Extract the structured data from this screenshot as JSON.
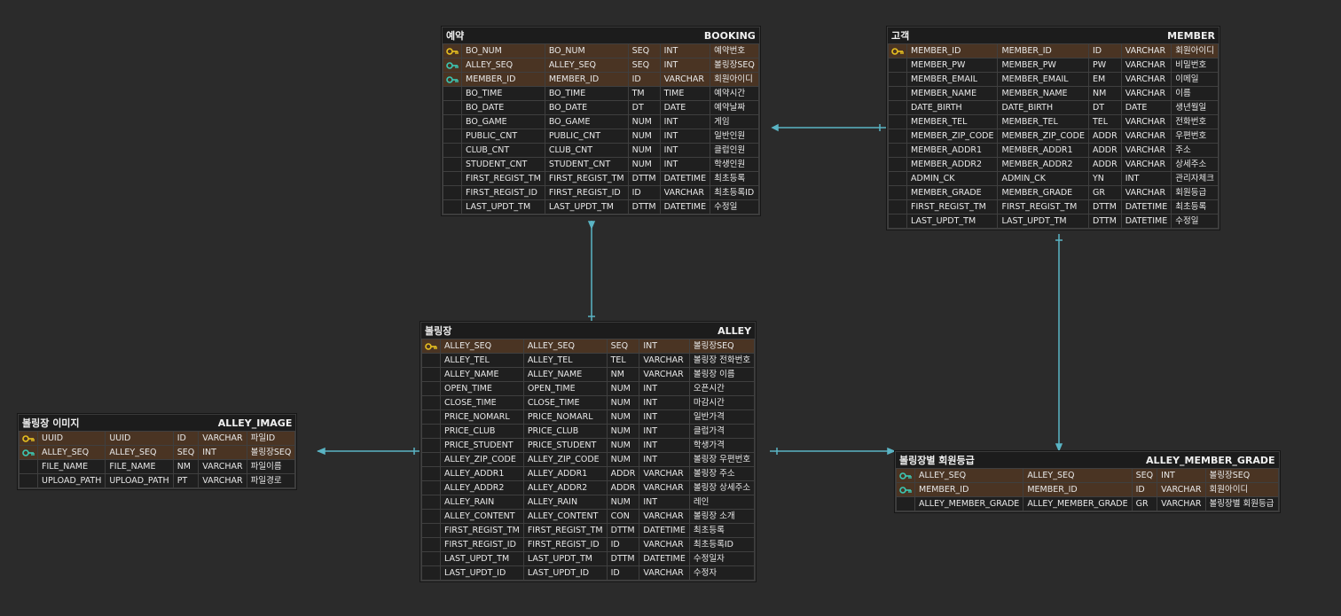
{
  "colors": {
    "background": "#2b2b2b",
    "connector": "#5ab4c4",
    "pk_key": "#e8c020",
    "fk_key": "#3cc8b4",
    "key_row": "#4a3423",
    "highlight_type": "#e0584c"
  },
  "entities": {
    "booking": {
      "logical": "예약",
      "physical": "BOOKING",
      "columns": [
        {
          "key": "pk",
          "c1": "BO_NUM",
          "c2": "BO_NUM",
          "dom": "SEQ",
          "type": "INT",
          "red": true,
          "comment": "예약번호"
        },
        {
          "key": "fk",
          "c1": "ALLEY_SEQ",
          "c2": "ALLEY_SEQ",
          "dom": "SEQ",
          "type": "INT",
          "red": true,
          "comment": "볼링장SEQ"
        },
        {
          "key": "fk",
          "c1": "MEMBER_ID",
          "c2": "MEMBER_ID",
          "dom": "ID",
          "type": "VARCHAR",
          "red": false,
          "comment": "회원아이디"
        },
        {
          "key": "",
          "c1": "BO_TIME",
          "c2": "BO_TIME",
          "dom": "TM",
          "type": "TIME",
          "red": true,
          "comment": "예약시간"
        },
        {
          "key": "",
          "c1": "BO_DATE",
          "c2": "BO_DATE",
          "dom": "DT",
          "type": "DATE",
          "red": true,
          "comment": "예약날짜"
        },
        {
          "key": "",
          "c1": "BO_GAME",
          "c2": "BO_GAME",
          "dom": "NUM",
          "type": "INT",
          "red": false,
          "comment": "게임"
        },
        {
          "key": "",
          "c1": "PUBLIC_CNT",
          "c2": "PUBLIC_CNT",
          "dom": "NUM",
          "type": "INT",
          "red": false,
          "comment": "일반인원"
        },
        {
          "key": "",
          "c1": "CLUB_CNT",
          "c2": "CLUB_CNT",
          "dom": "NUM",
          "type": "INT",
          "red": false,
          "comment": "클럽인원"
        },
        {
          "key": "",
          "c1": "STUDENT_CNT",
          "c2": "STUDENT_CNT",
          "dom": "NUM",
          "type": "INT",
          "red": false,
          "comment": "학생인원"
        },
        {
          "key": "",
          "c1": "FIRST_REGIST_TM",
          "c2": "FIRST_REGIST_TM",
          "dom": "DTTM",
          "type": "DATETIME",
          "red": false,
          "comment": "최초등록"
        },
        {
          "key": "",
          "c1": "FIRST_REGIST_ID",
          "c2": "FIRST_REGIST_ID",
          "dom": "ID",
          "type": "VARCHAR",
          "red": false,
          "comment": "최초등록ID"
        },
        {
          "key": "",
          "c1": "LAST_UPDT_TM",
          "c2": "LAST_UPDT_TM",
          "dom": "DTTM",
          "type": "DATETIME",
          "red": false,
          "comment": "수정일"
        }
      ]
    },
    "member": {
      "logical": "고객",
      "physical": "MEMBER",
      "columns": [
        {
          "key": "pk",
          "c1": "MEMBER_ID",
          "c2": "MEMBER_ID",
          "dom": "ID",
          "type": "VARCHAR",
          "red": false,
          "comment": "회원아이디"
        },
        {
          "key": "",
          "c1": "MEMBER_PW",
          "c2": "MEMBER_PW",
          "dom": "PW",
          "type": "VARCHAR",
          "red": false,
          "comment": "비밀번호"
        },
        {
          "key": "",
          "c1": "MEMBER_EMAIL",
          "c2": "MEMBER_EMAIL",
          "dom": "EM",
          "type": "VARCHAR",
          "red": false,
          "comment": "이메일"
        },
        {
          "key": "",
          "c1": "MEMBER_NAME",
          "c2": "MEMBER_NAME",
          "dom": "NM",
          "type": "VARCHAR",
          "red": false,
          "comment": "이름"
        },
        {
          "key": "",
          "c1": "DATE_BIRTH",
          "c2": "DATE_BIRTH",
          "dom": "DT",
          "type": "DATE",
          "red": true,
          "comment": "생년월일"
        },
        {
          "key": "",
          "c1": "MEMBER_TEL",
          "c2": "MEMBER_TEL",
          "dom": "TEL",
          "type": "VARCHAR",
          "red": false,
          "comment": "전화번호"
        },
        {
          "key": "",
          "c1": "MEMBER_ZIP_CODE",
          "c2": "MEMBER_ZIP_CODE",
          "dom": "ADDR",
          "type": "VARCHAR",
          "red": false,
          "comment": "우편번호"
        },
        {
          "key": "",
          "c1": "MEMBER_ADDR1",
          "c2": "MEMBER_ADDR1",
          "dom": "ADDR",
          "type": "VARCHAR",
          "red": false,
          "comment": "주소"
        },
        {
          "key": "",
          "c1": "MEMBER_ADDR2",
          "c2": "MEMBER_ADDR2",
          "dom": "ADDR",
          "type": "VARCHAR",
          "red": false,
          "comment": "상세주소"
        },
        {
          "key": "",
          "c1": "ADMIN_CK",
          "c2": "ADMIN_CK",
          "dom": "YN",
          "type": "INT",
          "red": true,
          "comment": "관리자체크"
        },
        {
          "key": "",
          "c1": "MEMBER_GRADE",
          "c2": "MEMBER_GRADE",
          "dom": "GR",
          "type": "VARCHAR",
          "red": false,
          "comment": "회원등급"
        },
        {
          "key": "",
          "c1": "FIRST_REGIST_TM",
          "c2": "FIRST_REGIST_TM",
          "dom": "DTTM",
          "type": "DATETIME",
          "red": false,
          "comment": "최초등록"
        },
        {
          "key": "",
          "c1": "LAST_UPDT_TM",
          "c2": "LAST_UPDT_TM",
          "dom": "DTTM",
          "type": "DATETIME",
          "red": false,
          "comment": "수정일"
        }
      ]
    },
    "alley": {
      "logical": "볼링장",
      "physical": "ALLEY",
      "columns": [
        {
          "key": "pk",
          "c1": "ALLEY_SEQ",
          "c2": "ALLEY_SEQ",
          "dom": "SEQ",
          "type": "INT",
          "red": true,
          "comment": "볼링장SEQ"
        },
        {
          "key": "",
          "c1": "ALLEY_TEL",
          "c2": "ALLEY_TEL",
          "dom": "TEL",
          "type": "VARCHAR",
          "red": false,
          "comment": "볼링장 전화번호"
        },
        {
          "key": "",
          "c1": "ALLEY_NAME",
          "c2": "ALLEY_NAME",
          "dom": "NM",
          "type": "VARCHAR",
          "red": false,
          "comment": "볼링장 이름"
        },
        {
          "key": "",
          "c1": "OPEN_TIME",
          "c2": "OPEN_TIME",
          "dom": "NUM",
          "type": "INT",
          "red": false,
          "comment": "오픈시간"
        },
        {
          "key": "",
          "c1": "CLOSE_TIME",
          "c2": "CLOSE_TIME",
          "dom": "NUM",
          "type": "INT",
          "red": false,
          "comment": "마감시간"
        },
        {
          "key": "",
          "c1": "PRICE_NOMARL",
          "c2": "PRICE_NOMARL",
          "dom": "NUM",
          "type": "INT",
          "red": false,
          "comment": "일반가격"
        },
        {
          "key": "",
          "c1": "PRICE_CLUB",
          "c2": "PRICE_CLUB",
          "dom": "NUM",
          "type": "INT",
          "red": false,
          "comment": "클럽가격"
        },
        {
          "key": "",
          "c1": "PRICE_STUDENT",
          "c2": "PRICE_STUDENT",
          "dom": "NUM",
          "type": "INT",
          "red": false,
          "comment": "학생가격"
        },
        {
          "key": "",
          "c1": "ALLEY_ZIP_CODE",
          "c2": "ALLEY_ZIP_CODE",
          "dom": "NUM",
          "type": "INT",
          "red": false,
          "comment": "볼링장 우편번호"
        },
        {
          "key": "",
          "c1": "ALLEY_ADDR1",
          "c2": "ALLEY_ADDR1",
          "dom": "ADDR",
          "type": "VARCHAR",
          "red": false,
          "comment": "볼링장 주소"
        },
        {
          "key": "",
          "c1": "ALLEY_ADDR2",
          "c2": "ALLEY_ADDR2",
          "dom": "ADDR",
          "type": "VARCHAR",
          "red": false,
          "comment": "볼링장 상세주소"
        },
        {
          "key": "",
          "c1": "ALLEY_RAIN",
          "c2": "ALLEY_RAIN",
          "dom": "NUM",
          "type": "INT",
          "red": false,
          "comment": "레인"
        },
        {
          "key": "",
          "c1": "ALLEY_CONTENT",
          "c2": "ALLEY_CONTENT",
          "dom": "CON",
          "type": "VARCHAR",
          "red": false,
          "comment": "볼링장 소개"
        },
        {
          "key": "",
          "c1": "FIRST_REGIST_TM",
          "c2": "FIRST_REGIST_TM",
          "dom": "DTTM",
          "type": "DATETIME",
          "red": false,
          "comment": "최초등록"
        },
        {
          "key": "",
          "c1": "FIRST_REGIST_ID",
          "c2": "FIRST_REGIST_ID",
          "dom": "ID",
          "type": "VARCHAR",
          "red": false,
          "comment": "최초등록ID"
        },
        {
          "key": "",
          "c1": "LAST_UPDT_TM",
          "c2": "LAST_UPDT_TM",
          "dom": "DTTM",
          "type": "DATETIME",
          "red": false,
          "comment": "수정일자"
        },
        {
          "key": "",
          "c1": "LAST_UPDT_ID",
          "c2": "LAST_UPDT_ID",
          "dom": "ID",
          "type": "VARCHAR",
          "red": false,
          "comment": "수정자"
        }
      ]
    },
    "alley_image": {
      "logical": "볼링장 이미지",
      "physical": "ALLEY_IMAGE",
      "columns": [
        {
          "key": "pk",
          "c1": "UUID",
          "c2": "UUID",
          "dom": "ID",
          "type": "VARCHAR",
          "red": false,
          "comment": "파일ID"
        },
        {
          "key": "fk",
          "c1": "ALLEY_SEQ",
          "c2": "ALLEY_SEQ",
          "dom": "SEQ",
          "type": "INT",
          "red": true,
          "comment": "볼링장SEQ"
        },
        {
          "key": "",
          "c1": "FILE_NAME",
          "c2": "FILE_NAME",
          "dom": "NM",
          "type": "VARCHAR",
          "red": false,
          "comment": "파일이름"
        },
        {
          "key": "",
          "c1": "UPLOAD_PATH",
          "c2": "UPLOAD_PATH",
          "dom": "PT",
          "type": "VARCHAR",
          "red": false,
          "comment": "파일경로"
        }
      ]
    },
    "alley_member_grade": {
      "logical": "볼링장별 회원등급",
      "physical": "ALLEY_MEMBER_GRADE",
      "columns": [
        {
          "key": "fk",
          "c1": "ALLEY_SEQ",
          "c2": "ALLEY_SEQ",
          "dom": "SEQ",
          "type": "INT",
          "red": true,
          "comment": "볼링장SEQ"
        },
        {
          "key": "fk",
          "c1": "MEMBER_ID",
          "c2": "MEMBER_ID",
          "dom": "ID",
          "type": "VARCHAR",
          "red": false,
          "comment": "회원아이디"
        },
        {
          "key": "",
          "c1": "ALLEY_MEMBER_GRADE",
          "c2": "ALLEY_MEMBER_GRADE",
          "dom": "GR",
          "type": "VARCHAR",
          "red": false,
          "comment": "볼링장별 회원등급"
        }
      ]
    }
  }
}
